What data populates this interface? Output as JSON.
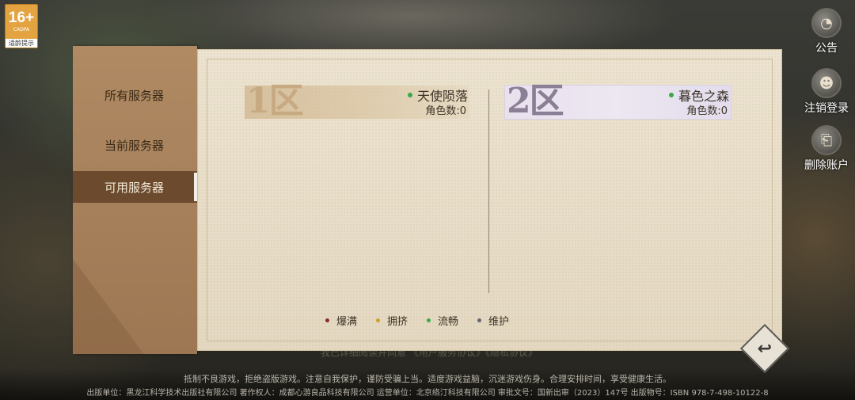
{
  "age_rating": {
    "number": "16+",
    "org": "CADPA",
    "tip": "适龄提示"
  },
  "side_buttons": {
    "notice": "公告",
    "logout": "注销登录",
    "delete_account": "删除账户"
  },
  "tabs": [
    {
      "label": "所有服务器",
      "active": false
    },
    {
      "label": "当前服务器",
      "active": false
    },
    {
      "label": "可用服务器",
      "active": true
    }
  ],
  "servers": [
    {
      "zone": "1区",
      "name": "天使陨落",
      "role_count": "角色数:0",
      "status_color": "#3aa84a"
    },
    {
      "zone": "2区",
      "name": "暮色之森",
      "role_count": "角色数:0",
      "status_color": "#3aa84a"
    }
  ],
  "legend": [
    {
      "label": "爆满",
      "color": "#8a2a2a"
    },
    {
      "label": "拥挤",
      "color": "#c9a227"
    },
    {
      "label": "流畅",
      "color": "#3aa84a"
    },
    {
      "label": "维护",
      "color": "#5e6772"
    }
  ],
  "under_text": "我已详细阅读并同意 《用户服务协议》《隐私协议》",
  "footer": {
    "line1": "抵制不良游戏，拒绝盗版游戏。注意自我保护，谨防受骗上当。适度游戏益脑，沉迷游戏伤身。合理安排时间，享受健康生活。",
    "line2": "出版单位：黑龙江科学技术出版社有限公司   著作权人：成都心游良品科技有限公司   运营单位：北京络汀科技有限公司   审批文号：国新出审（2023）147号   出版物号：ISBN 978-7-498-10122-8"
  }
}
